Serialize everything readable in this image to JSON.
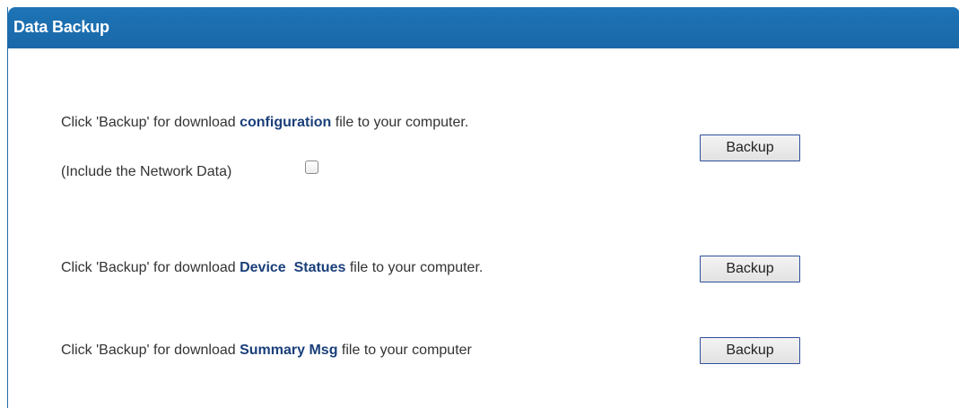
{
  "panel": {
    "title": "Data Backup"
  },
  "rows": [
    {
      "prefix": "Click 'Backup' for download ",
      "bold": "configuration",
      "suffix": " file to your computer.",
      "button_label": "Backup"
    },
    {
      "prefix": "Click 'Backup' for download ",
      "bold": "Device  Statues",
      "suffix": " file to your computer.",
      "button_label": "Backup"
    },
    {
      "prefix": "Click 'Backup' for download ",
      "bold": "Summary Msg",
      "suffix": " file to your computer",
      "button_label": "Backup"
    }
  ],
  "network_option": {
    "label": "(Include the Network Data)",
    "checked": false
  },
  "colors": {
    "header_bg": "#1d74b6",
    "bold_text": "#1a3f7a",
    "button_border": "#2e4f9c"
  }
}
